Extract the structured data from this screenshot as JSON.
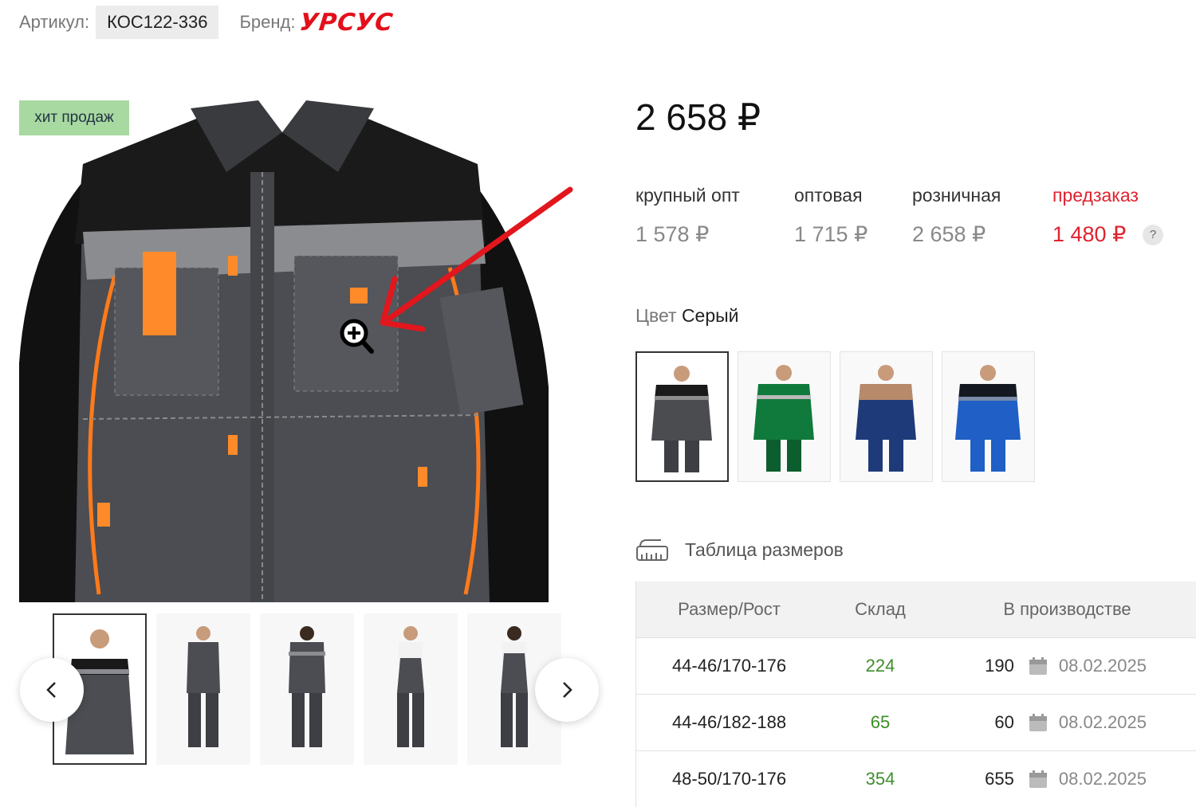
{
  "meta": {
    "sku_label": "Артикул:",
    "sku": "КОС122-336",
    "brand_label": "Бренд:",
    "brand": "УРСУС"
  },
  "gallery": {
    "badge": "хит продаж",
    "zoom_icon": "zoom-in-icon",
    "prev_icon": "chevron-left-icon",
    "next_icon": "chevron-right-icon",
    "thumbnails": [
      "jacket-front",
      "suit-front",
      "suit-back",
      "overalls-front",
      "overalls-back"
    ]
  },
  "price": {
    "main": "2 658 ₽",
    "tiers": [
      {
        "label": "крупный опт",
        "value": "1 578 ₽"
      },
      {
        "label": "оптовая",
        "value": "1 715 ₽"
      },
      {
        "label": "розничная",
        "value": "2 658 ₽"
      },
      {
        "label": "предзаказ",
        "value": "1 480 ₽"
      }
    ],
    "help": "?"
  },
  "color": {
    "label": "Цвет",
    "value": "Серый",
    "swatches": [
      {
        "name": "gray-black",
        "main": "#4a4c50",
        "accent": "#1a1a1a",
        "stripe": "#8d8d8d"
      },
      {
        "name": "green",
        "main": "#0f7a3c",
        "accent": "#0d5e2e",
        "stripe": "#b9b9b9"
      },
      {
        "name": "navy-beige",
        "main": "#1f3a78",
        "accent": "#b68a6a",
        "stripe": "#c9b08f"
      },
      {
        "name": "blue-black",
        "main": "#1f5fc6",
        "accent": "#141820",
        "stripe": "#7b8aa8"
      }
    ]
  },
  "sizes": {
    "title": "Таблица размеров",
    "headers": [
      "Размер/Рост",
      "Склад",
      "В производстве"
    ],
    "rows": [
      {
        "size": "44-46/170-176",
        "stock": "224",
        "prod": "190",
        "date": "08.02.2025"
      },
      {
        "size": "44-46/182-188",
        "stock": "65",
        "prod": "60",
        "date": "08.02.2025"
      },
      {
        "size": "48-50/170-176",
        "stock": "354",
        "prod": "655",
        "date": "08.02.2025"
      }
    ]
  }
}
